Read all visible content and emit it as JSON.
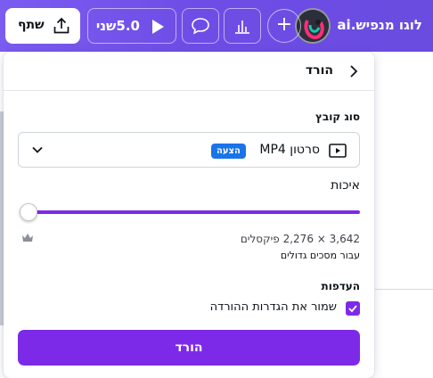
{
  "topbar": {
    "title": "לוגו מנפיש.ai",
    "play_label": "5.0שני",
    "share_label": "שתף",
    "icons": [
      "avatar",
      "plus-icon",
      "chart-icon",
      "comment-icon",
      "play-icon",
      "share-upload-icon"
    ]
  },
  "panel": {
    "title": "הורד",
    "file_type": {
      "section_label": "סוג קובץ",
      "value": "סרטון MP4",
      "badge": "הצעה"
    },
    "quality": {
      "label": "איכות",
      "level": 0
    },
    "dimensions": "3,642 × 2,276 פיקסלים",
    "dimensions_note": "עבור מסכים גדולים",
    "preferences": {
      "section_label": "העדפות",
      "save_settings_label": "שמור את הגדרות ההורדה",
      "save_settings_checked": true
    },
    "download_label": "הורד"
  },
  "colors": {
    "brand_purple": "#7d2ae8",
    "topbar_gradient_start": "#7b5cf0",
    "badge_blue": "#1a73e8"
  }
}
